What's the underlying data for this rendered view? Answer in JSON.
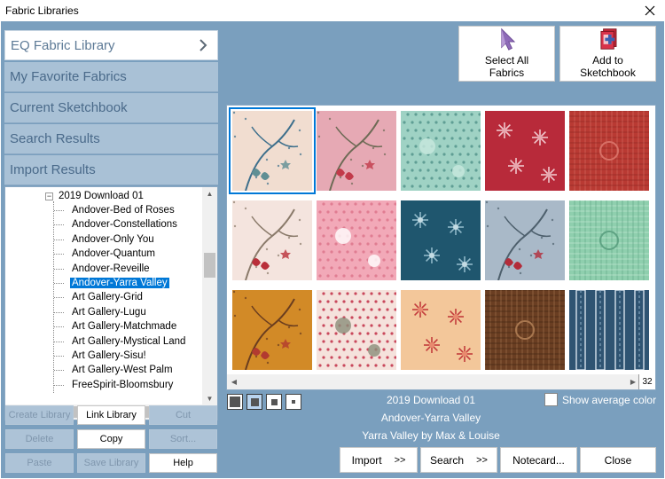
{
  "window": {
    "title": "Fabric Libraries"
  },
  "libraries": [
    {
      "label": "EQ Fabric Library",
      "active": true
    },
    {
      "label": "My Favorite Fabrics",
      "active": false
    },
    {
      "label": "Current Sketchbook",
      "active": false
    },
    {
      "label": "Search Results",
      "active": false
    },
    {
      "label": "Import Results",
      "active": false
    }
  ],
  "tree": {
    "parent": "2019 Download 01",
    "items": [
      "Andover-Bed of Roses",
      "Andover-Constellations",
      "Andover-Only You",
      "Andover-Quantum",
      "Andover-Reveille",
      "Andover-Yarra Valley",
      "Art Gallery-Grid",
      "Art Gallery-Lugu",
      "Art Gallery-Matchmade",
      "Art Gallery-Mystical Land",
      "Art Gallery-Sisu!",
      "Art Gallery-West Palm",
      "FreeSpirit-Bloomsbury"
    ],
    "selected_index": 5
  },
  "library_buttons": [
    {
      "label": "Create Library",
      "enabled": false
    },
    {
      "label": "Link Library",
      "enabled": true
    },
    {
      "label": "Cut",
      "enabled": false
    },
    {
      "label": "Delete",
      "enabled": false
    },
    {
      "label": "Copy",
      "enabled": true
    },
    {
      "label": "Sort...",
      "enabled": false
    },
    {
      "label": "Paste",
      "enabled": false
    },
    {
      "label": "Save Library",
      "enabled": false
    },
    {
      "label": "Help",
      "enabled": true
    }
  ],
  "toolbar": {
    "select_all_line1": "Select All",
    "select_all_line2": "Fabrics",
    "add_line1": "Add to",
    "add_line2": "Sketchbook"
  },
  "gallery": {
    "count": "32",
    "swatches": [
      {
        "bg": "#f1ddd0",
        "motif": "#3d6f8c",
        "accent": "#5f8f94",
        "pattern": "floral"
      },
      {
        "bg": "#e6a9b4",
        "motif": "#6d6a55",
        "accent": "#c23a4a",
        "pattern": "floral"
      },
      {
        "bg": "#9fd2c4",
        "motif": "#5f9e94",
        "accent": "#c8e8df",
        "pattern": "dots"
      },
      {
        "bg": "#b82a3a",
        "motif": "#f0c7cc",
        "accent": "#e8a6ae",
        "pattern": "medallion"
      },
      {
        "bg": "#b93a33",
        "motif": "#d87066",
        "accent": "#8c2622",
        "pattern": "grid"
      },
      {
        "bg": "#f4e4de",
        "motif": "#8a7a6a",
        "accent": "#b92f3a",
        "pattern": "floral"
      },
      {
        "bg": "#f2a9b8",
        "motif": "#e07d92",
        "accent": "#ffffff",
        "pattern": "dots"
      },
      {
        "bg": "#1f566e",
        "motif": "#8fb8c8",
        "accent": "#c5dce4",
        "pattern": "medallion"
      },
      {
        "bg": "#a9b9c8",
        "motif": "#4d5f6c",
        "accent": "#b32c3a",
        "pattern": "floral"
      },
      {
        "bg": "#8fcfae",
        "motif": "#5ea383",
        "accent": "#c6ead8",
        "pattern": "grid"
      },
      {
        "bg": "#d28a27",
        "motif": "#6a3d1f",
        "accent": "#b23a30",
        "pattern": "floral"
      },
      {
        "bg": "#f5e2dc",
        "motif": "#c9485c",
        "accent": "#8b8f7a",
        "pattern": "dots"
      },
      {
        "bg": "#f3c79a",
        "motif": "#c33c3c",
        "accent": "#e88a6e",
        "pattern": "medallion"
      },
      {
        "bg": "#6a3e22",
        "motif": "#a8774f",
        "accent": "#3d2212",
        "pattern": "grid"
      },
      {
        "bg": "#2f5472",
        "motif": "#d6e2ec",
        "accent": "#8fb0c8",
        "pattern": "stripes"
      }
    ],
    "selected_index": 0
  },
  "info": {
    "library": "2019 Download 01",
    "collection": "Andover-Yarra Valley",
    "designer": "Yarra Valley by Max & Louise"
  },
  "show_average_color": {
    "label": "Show average color",
    "checked": false
  },
  "bottom_buttons": {
    "import": "Import",
    "search": "Search",
    "arrows": ">>",
    "notecard": "Notecard...",
    "close": "Close"
  },
  "icons": {
    "close": "close-icon",
    "chevron": "chevron-right-icon",
    "select_all": "cursor-arrow-icon",
    "add": "sketchbook-add-icon"
  }
}
